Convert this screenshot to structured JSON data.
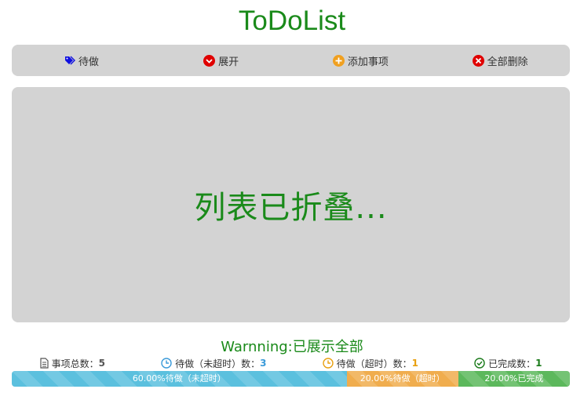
{
  "app": {
    "title": "ToDoList"
  },
  "toolbar": {
    "todo_label": "待做",
    "expand_label": "展开",
    "add_label": "添加事项",
    "delete_all_label": "全部删除"
  },
  "list": {
    "folded_text": "列表已折叠..."
  },
  "warning": {
    "text": "Warnning:已展示全部"
  },
  "stats": {
    "total_label": "事项总数：",
    "total_value": "5",
    "pending_label": "待做（未超时）数：",
    "pending_value": "3",
    "overdue_label": "待做（超时）数：",
    "overdue_value": "1",
    "done_label": "已完成数：",
    "done_value": "1"
  },
  "progress": {
    "segments": [
      {
        "label": "60.00%待做（未超时）",
        "fraction": 0.6,
        "color": "#5bc0de"
      },
      {
        "label": "20.00%待做（超时）",
        "fraction": 0.2,
        "color": "#f0ad4e"
      },
      {
        "label": "20.00%已完成",
        "fraction": 0.2,
        "color": "#5cb85c"
      }
    ]
  },
  "colors": {
    "accent_green": "#1a8a1a",
    "panel_gray": "#d3d3d3",
    "pending_blue": "#5bc0de",
    "overdue_orange": "#f0ad4e",
    "done_green": "#5cb85c"
  },
  "icons": {
    "todo": "tag-icon",
    "expand": "chevron-down-circle-icon",
    "add": "plus-circle-icon",
    "delete_all": "close-circle-icon",
    "total": "document-icon",
    "pending": "clock-icon",
    "overdue": "clock-icon",
    "done": "check-circle-icon"
  }
}
